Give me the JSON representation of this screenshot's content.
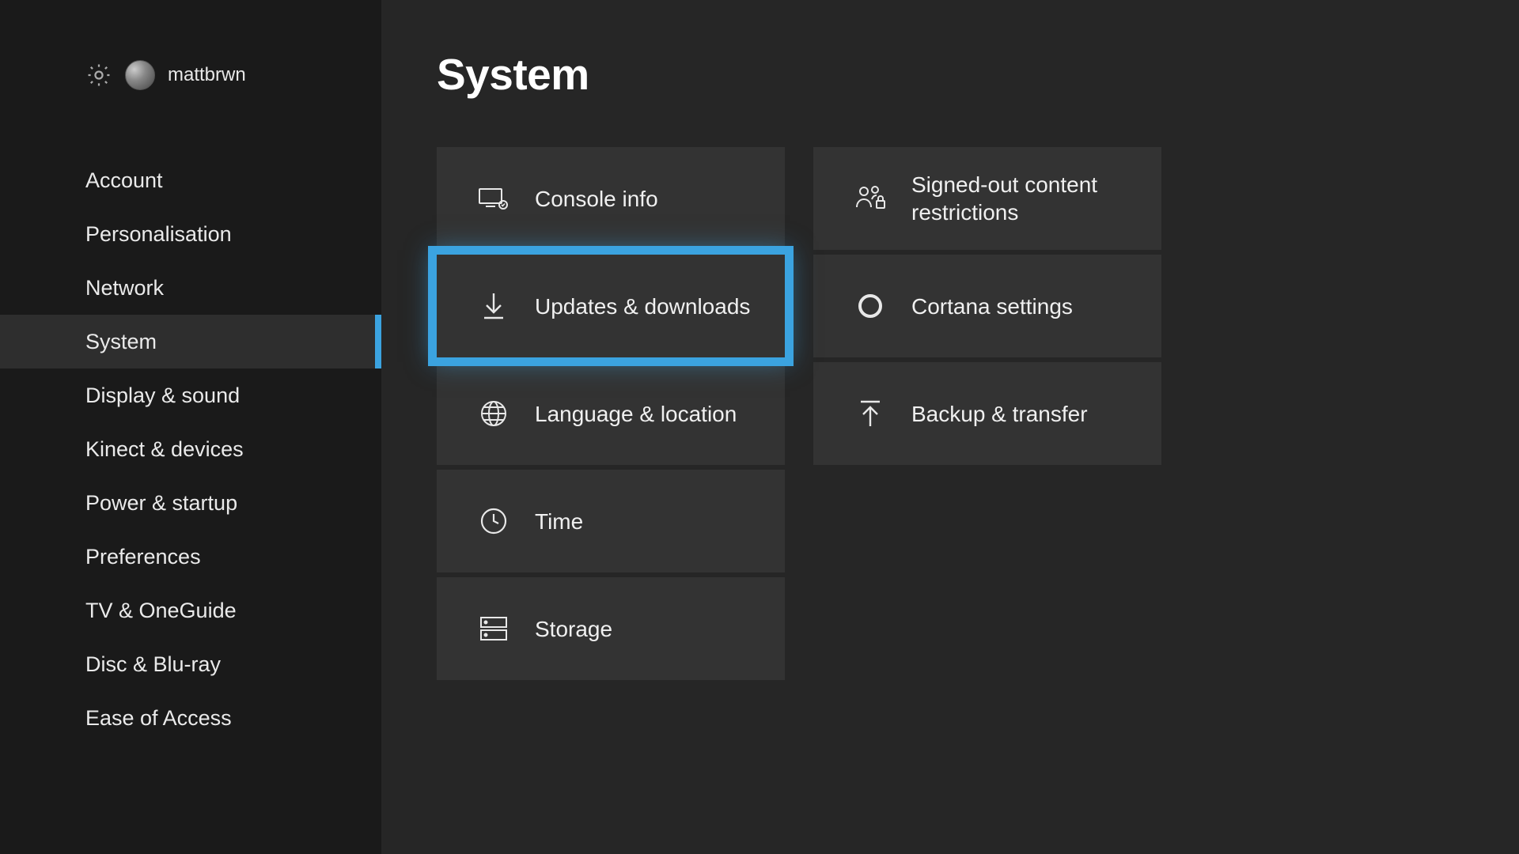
{
  "header": {
    "username": "mattbrwn"
  },
  "sidebar": {
    "items": [
      {
        "label": "Account",
        "active": false
      },
      {
        "label": "Personalisation",
        "active": false
      },
      {
        "label": "Network",
        "active": false
      },
      {
        "label": "System",
        "active": true
      },
      {
        "label": "Display & sound",
        "active": false
      },
      {
        "label": "Kinect & devices",
        "active": false
      },
      {
        "label": "Power & startup",
        "active": false
      },
      {
        "label": "Preferences",
        "active": false
      },
      {
        "label": "TV & OneGuide",
        "active": false
      },
      {
        "label": "Disc & Blu-ray",
        "active": false
      },
      {
        "label": "Ease of Access",
        "active": false
      }
    ]
  },
  "main": {
    "title": "System",
    "columns": [
      [
        {
          "icon": "console-info-icon",
          "label": "Console info",
          "selected": false
        },
        {
          "icon": "download-icon",
          "label": "Updates & downloads",
          "selected": true
        },
        {
          "icon": "globe-icon",
          "label": "Language & location",
          "selected": false
        },
        {
          "icon": "clock-icon",
          "label": "Time",
          "selected": false
        },
        {
          "icon": "storage-icon",
          "label": "Storage",
          "selected": false
        }
      ],
      [
        {
          "icon": "people-lock-icon",
          "label": "Signed-out content restrictions",
          "selected": false
        },
        {
          "icon": "circle-icon",
          "label": "Cortana settings",
          "selected": false
        },
        {
          "icon": "upload-icon",
          "label": "Backup & transfer",
          "selected": false
        }
      ]
    ]
  }
}
